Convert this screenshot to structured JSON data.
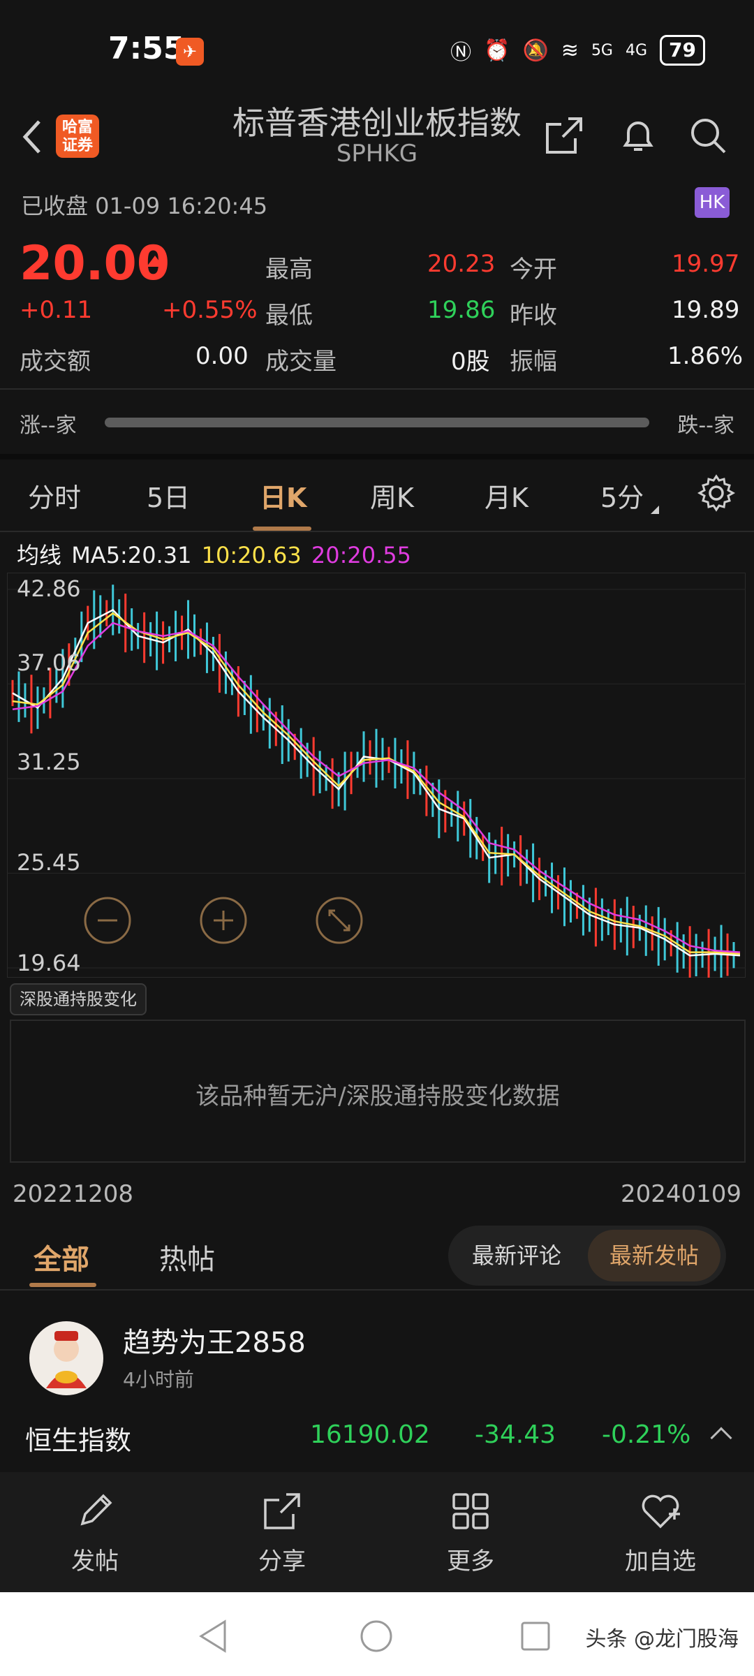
{
  "status_bar": {
    "time": "7:55",
    "battery": "79",
    "net1": "5G",
    "net2": "4G"
  },
  "nav": {
    "brand": "哈富证券",
    "title": "标普香港创业板指数",
    "subtitle": "SPHKG"
  },
  "market_state": "已收盘 01-09 16:20:45",
  "market_badge": "HK",
  "quote": {
    "price": "20.00",
    "change": "+0.11",
    "change_pct": "+0.55%",
    "high_label": "最高",
    "high": "20.23",
    "open_label": "今开",
    "open": "19.97",
    "low_label": "最低",
    "low": "19.86",
    "prev_close_label": "昨收",
    "prev_close": "19.89",
    "turnover_label": "成交额",
    "turnover": "0.00",
    "volume_label": "成交量",
    "volume": "0股",
    "amplitude_label": "振幅",
    "amplitude": "1.86%"
  },
  "breadth": {
    "up_label": "涨--家",
    "down_label": "跌--家"
  },
  "chart_tabs": [
    "分时",
    "5日",
    "日K",
    "周K",
    "月K",
    "5分"
  ],
  "active_tab": "日K",
  "ma_legend": {
    "prefix": "均线",
    "ma5": "MA5:20.31",
    "ma10": "10:20.63",
    "ma20": "20:20.55"
  },
  "colors": {
    "up": "#ff3b30",
    "down": "#2fd15a",
    "ma5": "#ffffff",
    "ma10": "#ffe24a",
    "ma20": "#e03ce0",
    "accent": "#e0a66a",
    "candle_down": "#3fc8d8"
  },
  "chart_data": {
    "type": "line",
    "ylim": [
      19.64,
      42.86
    ],
    "yticks": [
      "42.86",
      "37.06",
      "31.25",
      "25.45",
      "19.64"
    ],
    "xlabels": [
      "20221208",
      "20240109"
    ],
    "series": [
      {
        "name": "MA5",
        "values": [
          36.5,
          35.6,
          37.4,
          40.8,
          41.6,
          40.0,
          39.6,
          40.4,
          38.9,
          36.6,
          35.0,
          33.6,
          32.0,
          30.6,
          32.6,
          32.4,
          31.6,
          29.4,
          28.8,
          26.4,
          26.6,
          25.1,
          24.0,
          22.9,
          22.3,
          22.1,
          21.4,
          20.4,
          20.5,
          20.4
        ]
      },
      {
        "name": "10",
        "values": [
          36.0,
          35.8,
          37.0,
          40.2,
          41.4,
          40.3,
          39.8,
          40.2,
          39.2,
          37.0,
          35.3,
          33.9,
          32.3,
          30.8,
          32.4,
          32.5,
          31.7,
          29.8,
          28.9,
          26.7,
          26.6,
          25.3,
          24.2,
          23.1,
          22.5,
          22.2,
          21.6,
          20.6,
          20.6,
          20.5
        ]
      },
      {
        "name": "20",
        "values": [
          35.5,
          35.7,
          36.6,
          39.4,
          40.8,
          40.3,
          40.0,
          40.3,
          39.4,
          37.5,
          35.8,
          34.2,
          32.6,
          31.4,
          32.2,
          32.4,
          31.9,
          30.4,
          29.3,
          27.3,
          26.9,
          25.6,
          24.6,
          23.6,
          22.9,
          22.6,
          21.9,
          21.0,
          20.7,
          20.6
        ]
      }
    ]
  },
  "hold_tag": "深股通持股变化",
  "hold_empty": "该品种暂无沪/深股通持股变化数据",
  "feed": {
    "tab_all": "全部",
    "tab_hot": "热帖",
    "seg_comments": "最新评论",
    "seg_posts": "最新发帖"
  },
  "post": {
    "author": "趋势为王2858",
    "time": "4小时前"
  },
  "ticker": {
    "name": "恒生指数",
    "value": "16190.02",
    "change": "-34.43",
    "change_pct": "-0.21%"
  },
  "bottom_bar": {
    "post": "发帖",
    "share": "分享",
    "more": "更多",
    "watch": "加自选"
  },
  "watermark": "头条 @龙门股海"
}
